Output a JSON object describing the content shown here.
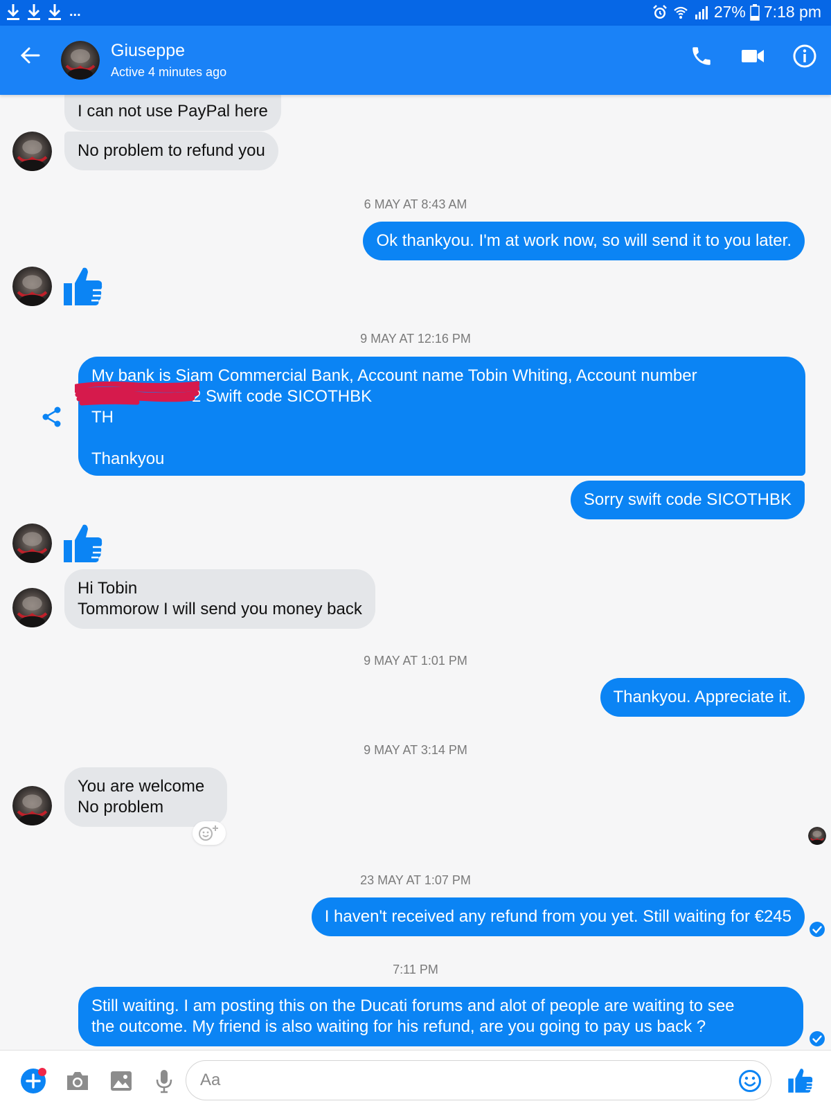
{
  "status_bar": {
    "overflow": "...",
    "battery": "27%",
    "time": "7:18 pm"
  },
  "header": {
    "name": "Giuseppe",
    "status": "Active 4 minutes ago"
  },
  "messages": {
    "m1": "I can not use PayPal here",
    "m2": "No problem to refund you",
    "t1": "6 MAY AT 8:43 AM",
    "m3": "Ok thankyou. I'm at work now, so will send it to you later.",
    "t2": "9 MAY AT 12:16 PM",
    "m4_line1": "My bank is Siam Commercial Bank, Account name Tobin Whiting,  Account number",
    "m4_line2": "2 Swift code SICOTHBK",
    "m4_line3": "TH",
    "m4_line4": "Thankyou",
    "m5": "Sorry swift code SICOTHBK",
    "m6": "Hi Tobin\nTommorow I will send you money back",
    "t3": "9 MAY AT 1:01 PM",
    "m7": "Thankyou. Appreciate it.",
    "t4": "9 MAY AT 3:14 PM",
    "m8": "You are welcome\nNo problem",
    "t5": "23 MAY AT 1:07 PM",
    "m9": "I haven't received any refund from you yet. Still waiting for €245",
    "t6": "7:11 PM",
    "m10": "Still waiting. I am posting this on the Ducati forums and alot of people are waiting to see\nthe outcome. My friend is also waiting for his refund, are you going to pay us back ?"
  },
  "composer": {
    "placeholder": "Aa"
  },
  "colors": {
    "status_bar": "#0667e6",
    "header": "#1a82f7",
    "outgoing_bubble": "#0b84f4",
    "incoming_bubble": "#e4e6e9"
  },
  "icons": [
    "download-icon",
    "alarm-icon",
    "wifi-icon",
    "signal-icon",
    "battery-icon",
    "back-arrow-icon",
    "phone-icon",
    "video-camera-icon",
    "info-icon",
    "thumbs-up-icon",
    "share-icon",
    "add-reaction-icon",
    "seen-check-icon",
    "plus-icon",
    "camera-icon",
    "image-icon",
    "microphone-icon",
    "emoji-icon"
  ]
}
